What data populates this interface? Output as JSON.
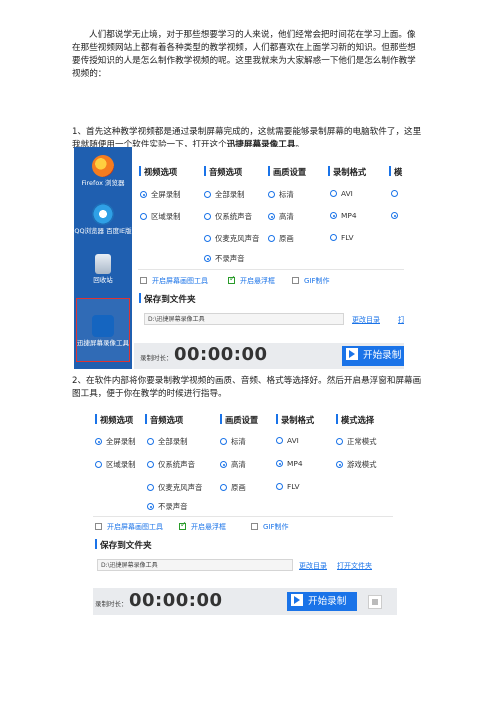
{
  "doc": {
    "intro": "人们都说学无止境，对于那些想要学习的人来说，他们经常会把时间花在学习上面。像在那些视频网站上都有着各种类型的教学视频，人们都喜欢在上面学习新的知识。但那些想要传授知识的人是怎么制作教学视频的呢。这里我就来为大家解惑一下他们是怎么制作教学视频的：",
    "step1_prefix": "1、首先这种教学视频都是通过录制屏幕完成的，这就需要能够录制屏幕的电脑软件了，这里我就随便用一个软件实验一下，打开这个",
    "step1_bold": "迅捷屏幕录像工具",
    "step1_suffix": "。",
    "step2": "2、在软件内部将你要录制教学视频的画质、音频、格式等选择好。然后开启悬浮窗和屏幕画图工具，便于你在教学的时候进行指导。"
  },
  "desktop": {
    "icons": [
      {
        "name": "firefox-icon",
        "label": "Firefox 浏览器",
        "color": "#f57c1f"
      },
      {
        "name": "qq-browser-icon",
        "label": "QQ浏览器 百度IE版",
        "color": "#2fa0e6"
      },
      {
        "name": "recycle-bin-icon",
        "label": "回收站",
        "color": "#cfd8e3"
      },
      {
        "name": "screen-recorder-icon",
        "label": "迅捷屏幕录像工具",
        "color": "#1565c0"
      }
    ]
  },
  "app": {
    "columns": {
      "video": "视频选项",
      "audio": "音频选项",
      "quality": "画质设置",
      "format": "录制格式",
      "mode": "模式选择",
      "mode_short": "模"
    },
    "video_opts": [
      "全屏录制",
      "区域录制"
    ],
    "audio_opts": [
      "全部录制",
      "仅系统声音",
      "仅麦克风声音",
      "不录声音"
    ],
    "quality_opts": [
      "标清",
      "高清",
      "原画"
    ],
    "format_opts": [
      "AVI",
      "MP4",
      "FLV"
    ],
    "mode_opts": [
      "正常模式",
      "游戏模式"
    ],
    "checks": [
      "开启屏幕画图工具",
      "开启悬浮框",
      "GIF制作"
    ],
    "save_title": "保存到文件夹",
    "save_path": "D:\\迅捷屏幕录像工具",
    "change_dir": "更改目录",
    "open_folder": "打开文件夹",
    "open_folder_short": "打",
    "rec_label": "录制时长：",
    "rec_time": "00:00:00",
    "start": "开始录制"
  }
}
